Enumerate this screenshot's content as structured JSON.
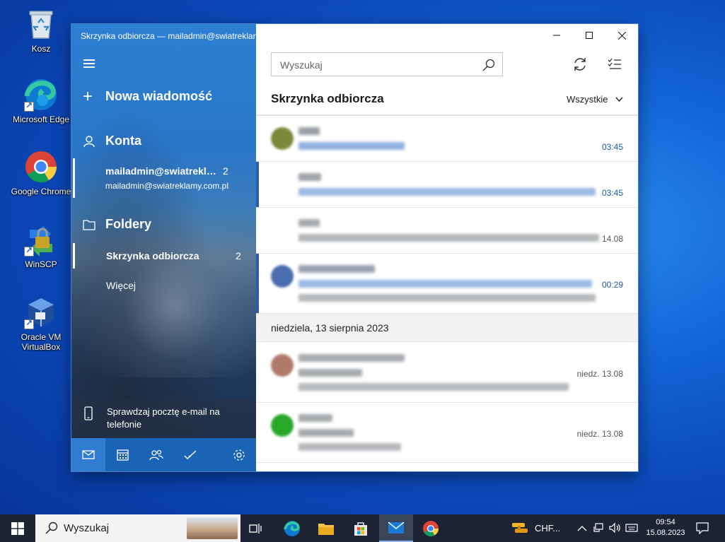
{
  "desktop": {
    "icons": [
      {
        "label": "Kosz"
      },
      {
        "label": "Microsoft Edge"
      },
      {
        "label": "Google Chrome"
      },
      {
        "label": "WinSCP"
      },
      {
        "label": "Oracle VM VirtualBox"
      }
    ]
  },
  "mail": {
    "window_title": "Skrzynka odbiorcza — mailadmin@swiatreklamy.com.pl",
    "new_message": "Nowa wiadomość",
    "accounts_heading": "Konta",
    "account": {
      "name": "mailadmin@swiatreklamy.com.pl",
      "email": "mailadmin@swiatreklamy.com.pl",
      "count": "2"
    },
    "folders_heading": "Foldery",
    "folders": [
      {
        "label": "Skrzynka odbiorcza",
        "count": "2"
      }
    ],
    "more": "Więcej",
    "phone_promo": "Sprawdzaj pocztę e-mail na telefonie",
    "search_placeholder": "Wyszukaj",
    "inbox_title": "Skrzynka odbiorcza",
    "filter": "Wszystkie",
    "messages": [
      {
        "time": "03:45",
        "unread": false,
        "avatar_color": "#7a8a3a"
      },
      {
        "time": "03:45",
        "unread": true,
        "avatar_color": null
      },
      {
        "time": "14.08",
        "unread": false,
        "avatar_color": null
      },
      {
        "time": "00:29",
        "unread": true,
        "avatar_color": "#4a6db0"
      },
      {
        "time": "niedz. 13.08",
        "unread": false,
        "avatar_color": "#b07a6a"
      },
      {
        "time": "niedz. 13.08",
        "unread": false,
        "avatar_color": "#28a828"
      }
    ],
    "date_separator": "niedziela, 13 sierpnia 2023"
  },
  "taskbar": {
    "search_placeholder": "Wyszukaj",
    "weather_text": "CHF...",
    "time": "09:54",
    "date": "15.08.2023"
  },
  "colors": {
    "accent": "#2a5ea8",
    "taskbar": "#1c2433",
    "unread_time": "#1d5aa6"
  }
}
